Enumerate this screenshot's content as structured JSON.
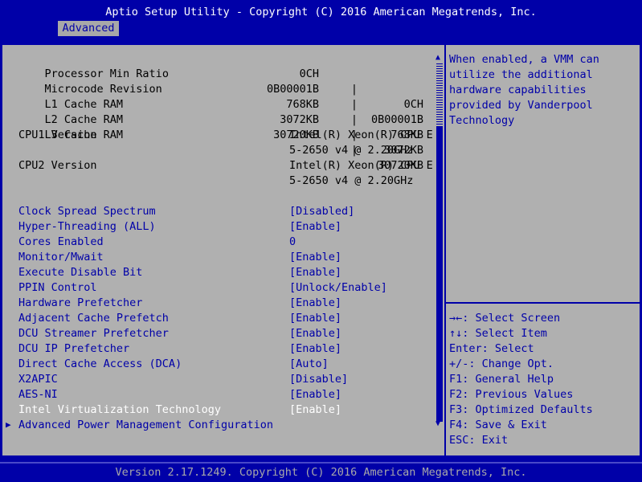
{
  "header": {
    "title": "Aptio Setup Utility - Copyright (C) 2016 American Megatrends, Inc.",
    "tabs": [
      "Advanced"
    ]
  },
  "info_rows": [
    {
      "label": "Processor Min Ratio",
      "v1": "0CH",
      "v2": "0CH"
    },
    {
      "label": "Microcode Revision",
      "v1": "0B00001B",
      "v2": "0B00001B"
    },
    {
      "label": "L1 Cache RAM",
      "v1": "768KB",
      "v2": "768KB"
    },
    {
      "label": "L2 Cache RAM",
      "v1": "3072KB",
      "v2": "3072KB"
    },
    {
      "label": "L3 Cache RAM",
      "v1": "30720KB",
      "v2": "30720KB"
    }
  ],
  "cpu_rows": [
    {
      "label": "CPU1 Version",
      "line1": "Intel(R) Xeon(R) CPU E",
      "line2": "5-2650 v4 @ 2.20GHz"
    },
    {
      "label": "CPU2 Version",
      "line1": "Intel(R) Xeon(R) CPU E",
      "line2": "5-2650 v4 @ 2.20GHz"
    }
  ],
  "options": [
    {
      "label": "Clock Spread Spectrum",
      "value": "[Disabled]"
    },
    {
      "label": "Hyper-Threading (ALL)",
      "value": "[Enable]"
    },
    {
      "label": "Cores Enabled",
      "value": "0"
    },
    {
      "label": "Monitor/Mwait",
      "value": "[Enable]"
    },
    {
      "label": "Execute Disable Bit",
      "value": "[Enable]"
    },
    {
      "label": "PPIN Control",
      "value": "[Unlock/Enable]"
    },
    {
      "label": "Hardware Prefetcher",
      "value": "[Enable]"
    },
    {
      "label": "Adjacent Cache Prefetch",
      "value": "[Enable]"
    },
    {
      "label": "DCU Streamer Prefetcher",
      "value": "[Enable]"
    },
    {
      "label": "DCU IP Prefetcher",
      "value": "[Enable]"
    },
    {
      "label": "Direct Cache Access (DCA)",
      "value": "[Auto]"
    },
    {
      "label": "X2APIC",
      "value": "[Disable]"
    },
    {
      "label": "AES-NI",
      "value": "[Enable]"
    },
    {
      "label": "Intel Virtualization Technology",
      "value": "[Enable]"
    }
  ],
  "submenu": {
    "label": "Advanced Power Management Configuration",
    "arrow": "▶"
  },
  "help": [
    "When enabled, a VMM can",
    "utilize the additional",
    "hardware capabilities",
    "provided by Vanderpool",
    "Technology"
  ],
  "keys": [
    "→←: Select Screen",
    "↑↓: Select Item",
    "Enter: Select",
    "+/-: Change Opt.",
    "F1: General Help",
    "F2: Previous Values",
    "F3: Optimized Defaults",
    "F4: Save & Exit",
    "ESC: Exit"
  ],
  "scroll": {
    "up": "▲",
    "down": "▼"
  },
  "footer": "Version 2.17.1249. Copyright (C) 2016 American Megatrends, Inc.",
  "colors": {
    "background": "#0000a8",
    "panel": "#b0b0b0",
    "option_text": "#0000a8",
    "selected_text": "#ffffff"
  }
}
